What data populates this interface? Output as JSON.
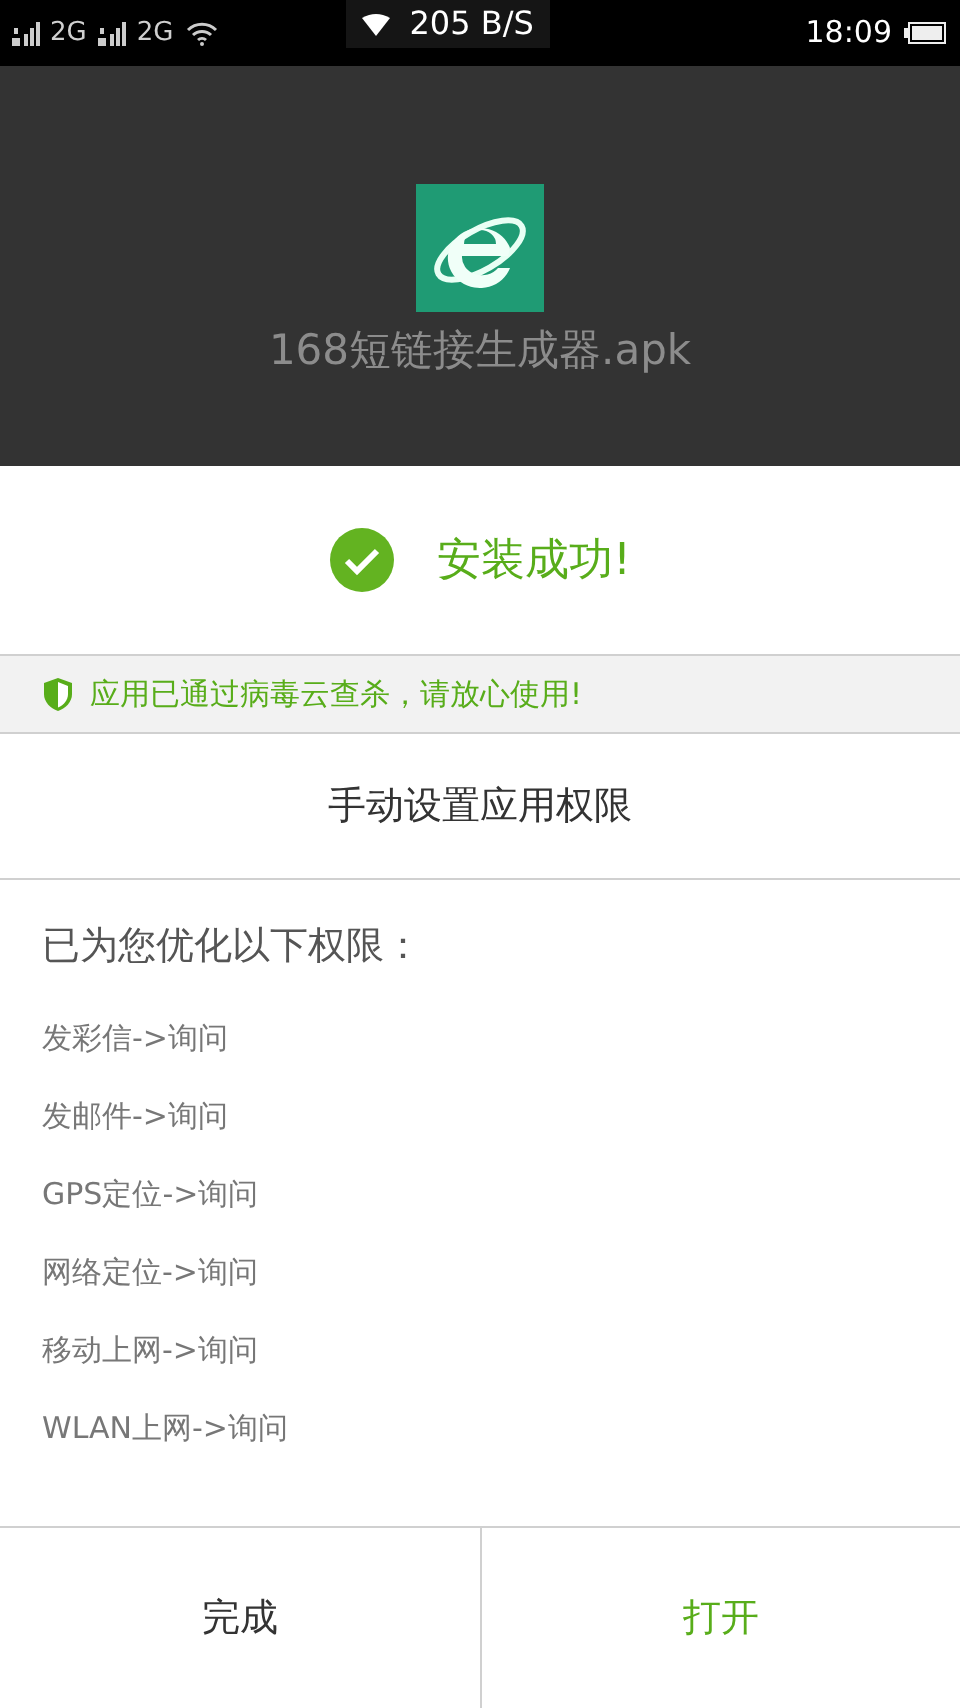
{
  "status_bar": {
    "sim_labels": [
      "2G",
      "2G"
    ],
    "speed": "205 B/S",
    "time": "18:09"
  },
  "app": {
    "file_name": "168短链接生成器.apk"
  },
  "result": {
    "message": "安装成功!"
  },
  "notice": {
    "text": "应用已通过病毒云查杀，请放心使用!"
  },
  "manual_settings": {
    "label": "手动设置应用权限"
  },
  "permissions": {
    "heading": "已为您优化以下权限：",
    "items": [
      "发彩信->询问",
      "发邮件->询问",
      "GPS定位->询问",
      "网络定位->询问",
      "移动上网->询问",
      "WLAN上网->询问"
    ]
  },
  "buttons": [
    {
      "label": "完成",
      "kind": "neutral"
    },
    {
      "label": "打开",
      "kind": "primary"
    }
  ]
}
